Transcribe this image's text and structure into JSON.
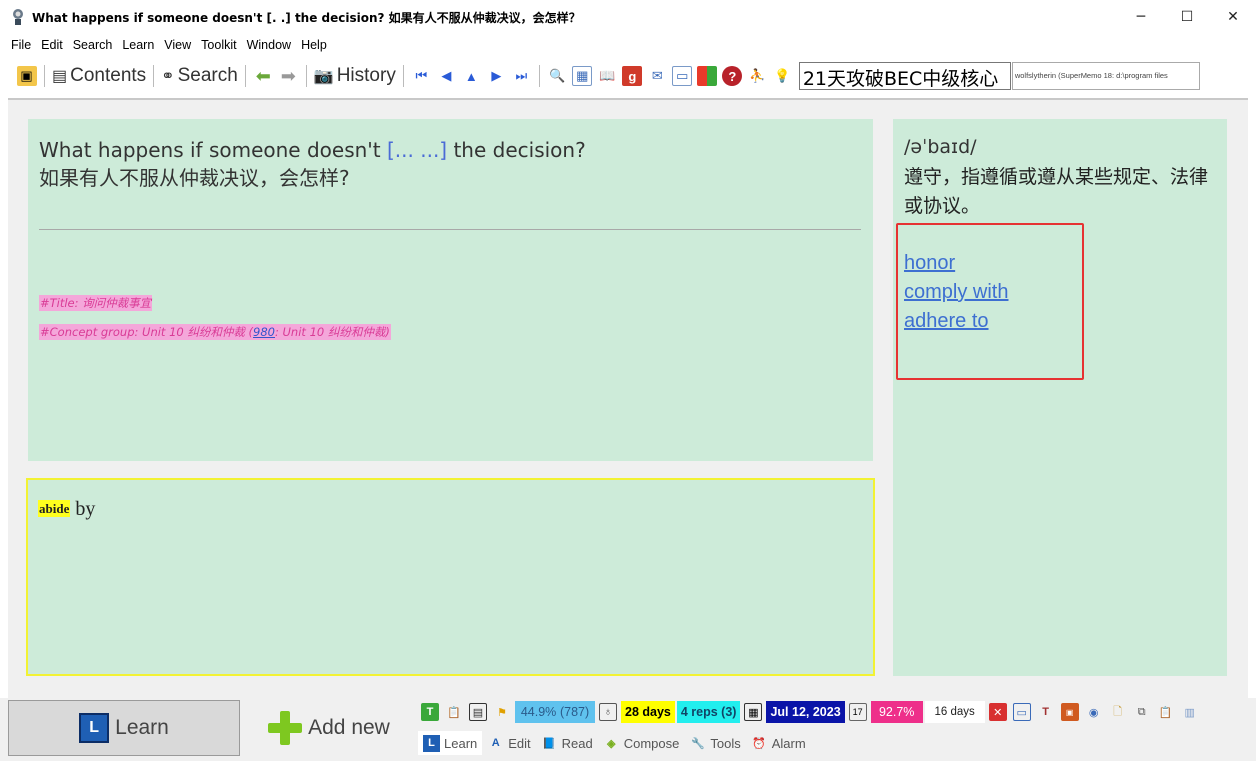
{
  "window": {
    "title": "What happens if someone doesn't [. .] the decision? 如果有人不服从仲裁决议，会怎样？",
    "controls": {
      "minimize": "─",
      "maximize": "☐",
      "close": "✕"
    }
  },
  "menu": [
    "File",
    "Edit",
    "Search",
    "Learn",
    "View",
    "Toolkit",
    "Window",
    "Help"
  ],
  "toolbar": {
    "contents_label": "Contents",
    "search_label": "Search",
    "history_label": "History",
    "search_field_value": "21天攻破BEC中级核心",
    "status_text": "wolfslytherin (SuperMemo 18: d:\\program files"
  },
  "question": {
    "line1_before": "What happens if someone doesn't ",
    "cloze": "[... ...]",
    "line1_after": " the decision?",
    "line2": "如果有人不服从仲裁决议，会怎样?",
    "tag_title": "#Title: 询问仲裁事宜",
    "tag_concept_before": "#Concept group: Unit 10 纠纷和仲裁 (",
    "tag_concept_link": "980",
    "tag_concept_after": ": Unit 10 纠纷和仲裁)"
  },
  "answer": {
    "highlight": "abide",
    "rest": " by"
  },
  "reference": {
    "phonetic": "/əˈbaɪd/",
    "meaning": "遵守，指遵循或遵从某些规定、法律或协议。",
    "synonyms": [
      "honor",
      "comply with",
      "adhere to"
    ]
  },
  "bottom": {
    "learn_label": "Learn",
    "learn_icon_letter": "L",
    "add_new_label": "Add new",
    "status": {
      "percent": "44.9%",
      "count": "(787)",
      "days": "28 days",
      "reps": "4 reps (3)",
      "date": "Jul 12, 2023",
      "retention": "92.7%",
      "interval": "16 days"
    },
    "tabs": [
      "Learn",
      "Edit",
      "Read",
      "Compose",
      "Tools",
      "Alarm"
    ]
  },
  "colors": {
    "panel_bg": "#cdebd9",
    "answer_border": "#f2f233",
    "highlight_box": "#e63232",
    "link": "#3d6fd1",
    "cloze": "#4a6bd6"
  }
}
